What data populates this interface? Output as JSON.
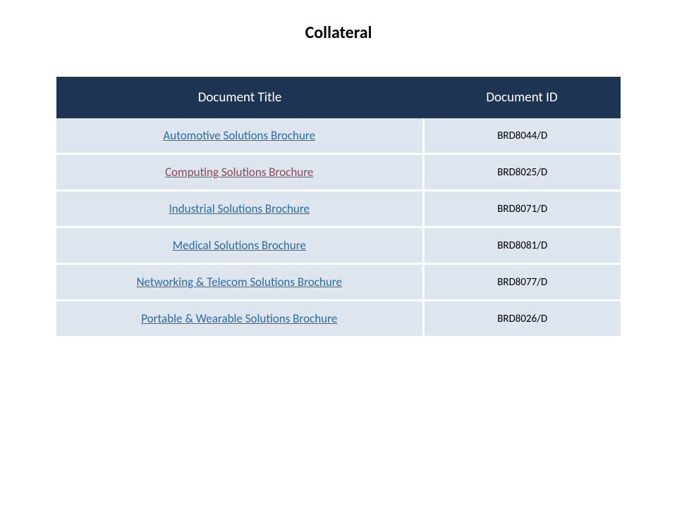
{
  "title": "Collateral",
  "table": {
    "headers": {
      "title": "Document Title",
      "id": "Document ID"
    },
    "rows": [
      {
        "title": "Automotive Solutions Brochure",
        "id": "BRD8044/D",
        "visited": false
      },
      {
        "title": "Computing Solutions Brochure",
        "id": "BRD8025/D",
        "visited": true
      },
      {
        "title": "Industrial Solutions Brochure",
        "id": "BRD8071/D",
        "visited": false
      },
      {
        "title": "Medical Solutions Brochure",
        "id": "BRD8081/D",
        "visited": false
      },
      {
        "title": "Networking & Telecom Solutions Brochure",
        "id": "BRD8077/D",
        "visited": false
      },
      {
        "title": "Portable & Wearable Solutions Brochure",
        "id": "BRD8026/D",
        "visited": false
      }
    ]
  }
}
